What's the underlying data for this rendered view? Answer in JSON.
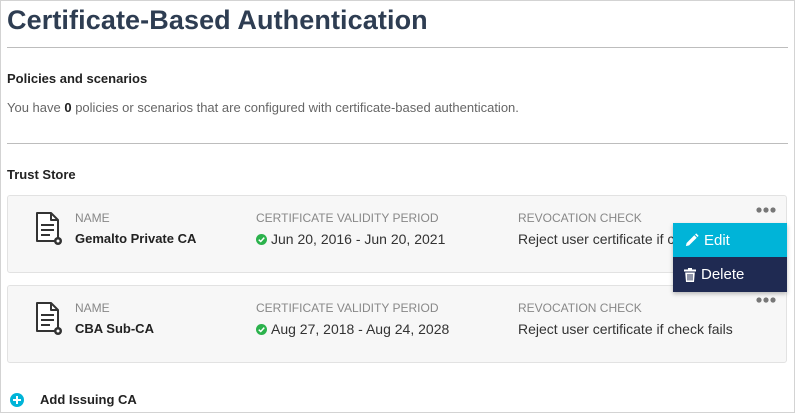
{
  "page": {
    "title": "Certificate-Based Authentication"
  },
  "policies": {
    "heading": "Policies and scenarios",
    "text_before": "You have ",
    "count": "0",
    "text_after": " policies or scenarios that are configured with certificate-based authentication."
  },
  "trust_store": {
    "heading": "Trust Store",
    "labels": {
      "name": "NAME",
      "validity": "CERTIFICATE VALIDITY PERIOD",
      "revocation": "REVOCATION CHECK"
    },
    "items": [
      {
        "name": "Gemalto Private CA",
        "validity": "Jun 20, 2016 - Jun 20, 2021",
        "revocation": "Reject user certificate if check fails"
      },
      {
        "name": "CBA Sub-CA",
        "validity": "Aug 27, 2018 - Aug 24, 2028",
        "revocation": "Reject user certificate if check fails"
      }
    ]
  },
  "context_menu": {
    "edit": "Edit",
    "delete": "Delete"
  },
  "add_issuing_ca": {
    "label": "Add Issuing CA"
  },
  "colors": {
    "title": "#2e3d52",
    "valid_check": "#2bb24c",
    "menu_edit": "#00b4d8",
    "menu_delete": "#1f2a52",
    "add_icon": "#00b4d8"
  },
  "icons": [
    "document-certificate-icon",
    "check-circle-icon",
    "more-dots-icon",
    "pencil-icon",
    "trash-icon",
    "plus-circle-icon"
  ]
}
